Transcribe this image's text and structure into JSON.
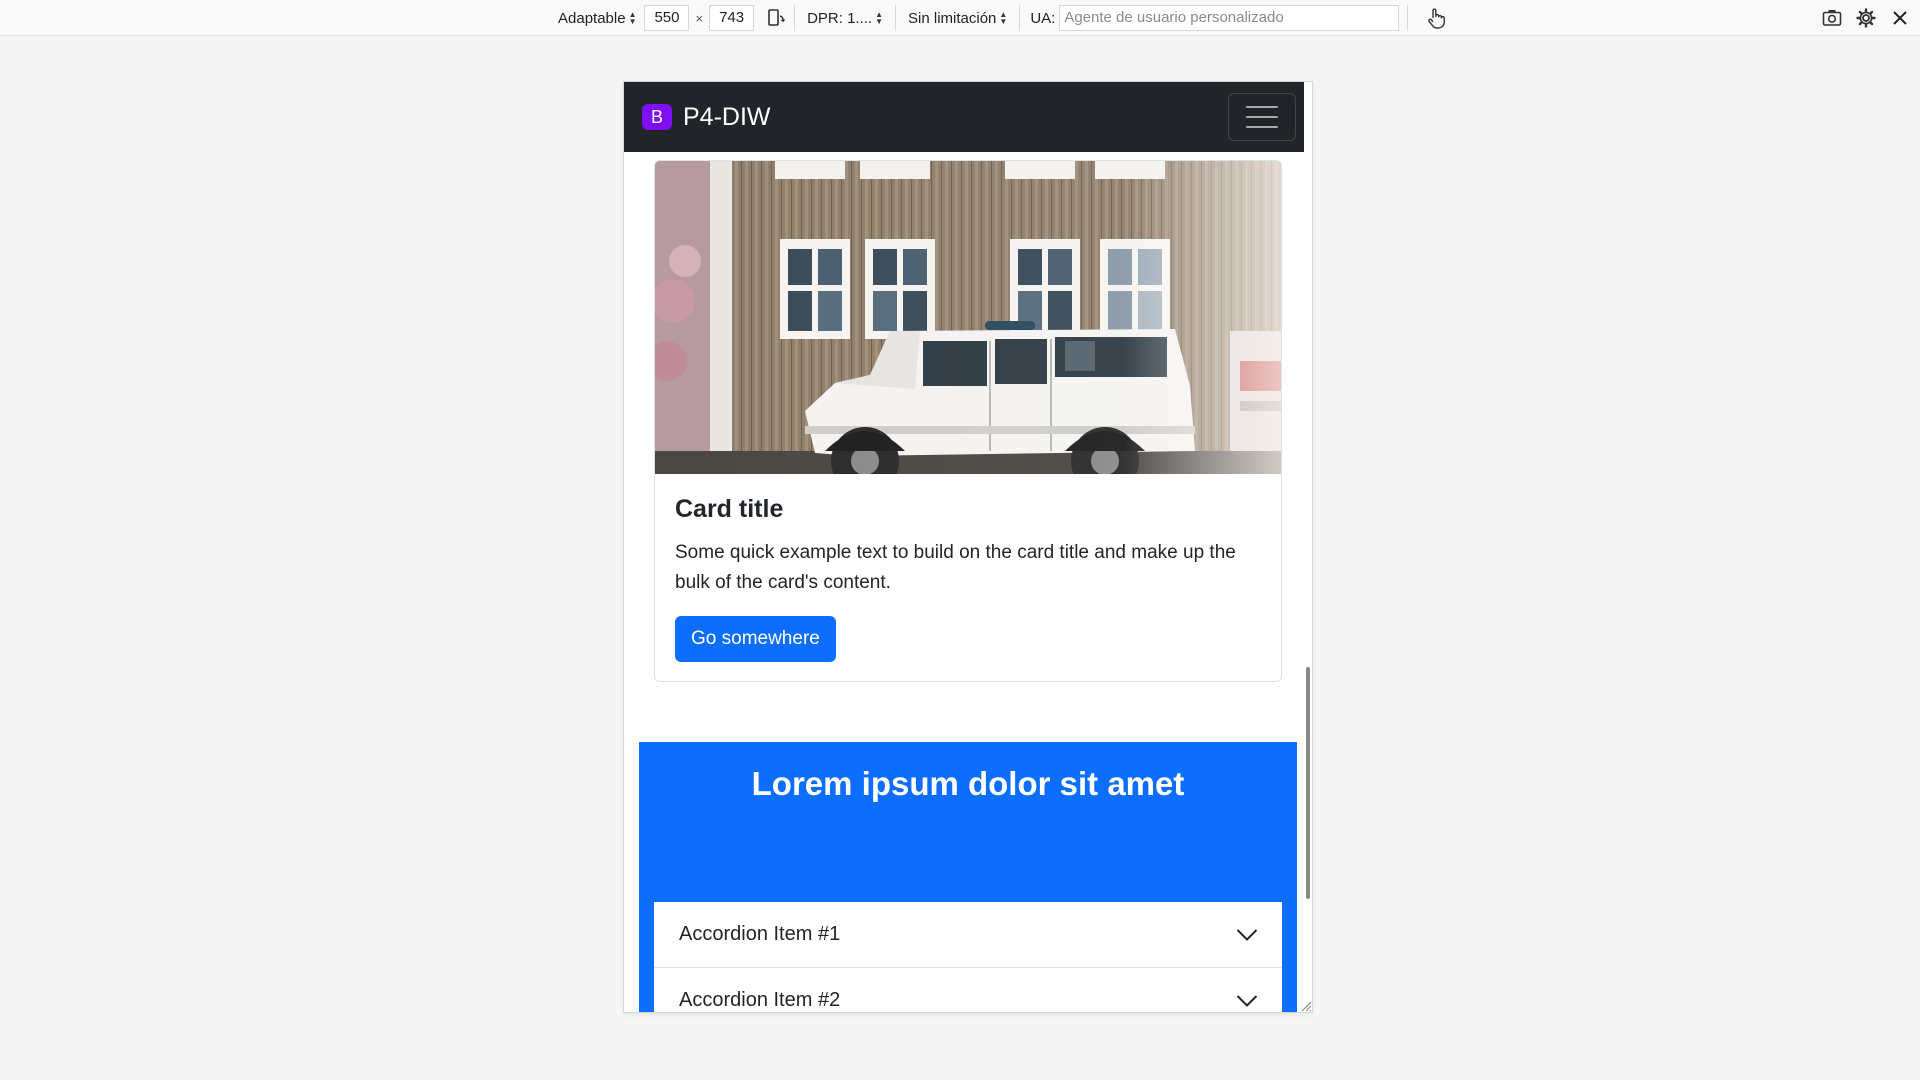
{
  "toolbar": {
    "device_label": "Adaptable",
    "width_value": "550",
    "times": "×",
    "height_value": "743",
    "dpr_label": "DPR: 1....",
    "throttle_label": "Sin limitación",
    "ua_label": "UA:",
    "ua_placeholder": "Agente de usuario personalizado",
    "icons": [
      "rotate-icon",
      "touch-icon",
      "screenshot-icon",
      "settings-icon",
      "close-icon"
    ]
  },
  "navbar": {
    "logo_letter": "B",
    "brand": "P4-DIW",
    "logo_color": "#7f10f5",
    "background": "#212529"
  },
  "card": {
    "title": "Card title",
    "text": "Some quick example text to build on the card title and make up the bulk of the card's content.",
    "button_label": "Go somewhere",
    "button_color": "#0d6efd"
  },
  "hero": {
    "title": "Lorem ipsum dolor sit amet",
    "background": "#0d6efd"
  },
  "accordion": {
    "items": [
      {
        "label": "Accordion Item #1"
      },
      {
        "label": "Accordion Item #2"
      }
    ]
  }
}
